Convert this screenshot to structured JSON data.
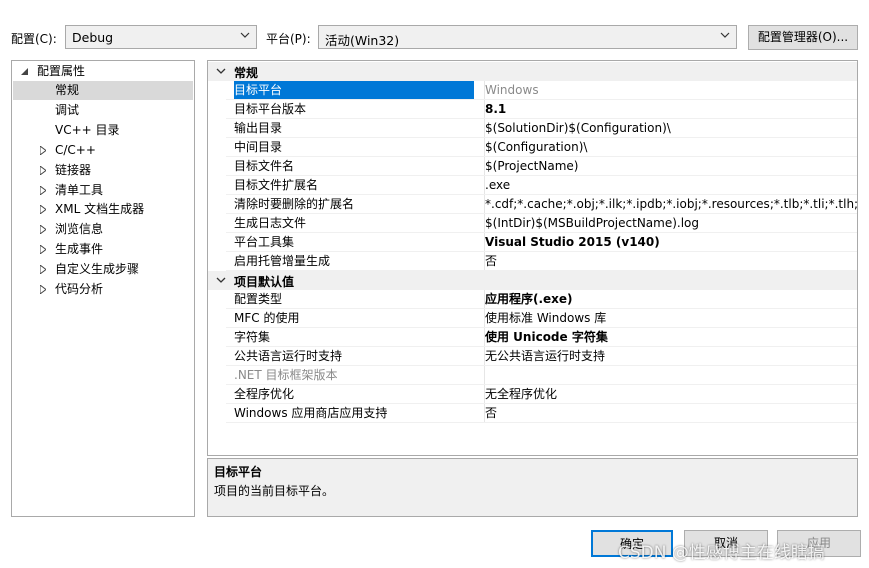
{
  "toolbar": {
    "config_label": "配置(C):",
    "config_value": "Debug",
    "platform_label": "平台(P):",
    "platform_value": "活动(Win32)",
    "config_manager_button": "配置管理器(O)..."
  },
  "tree": {
    "root": "配置属性",
    "items": [
      {
        "label": "常规",
        "expandable": false
      },
      {
        "label": "调试",
        "expandable": false
      },
      {
        "label": "VC++ 目录",
        "expandable": false
      },
      {
        "label": "C/C++",
        "expandable": true
      },
      {
        "label": "链接器",
        "expandable": true
      },
      {
        "label": "清单工具",
        "expandable": true
      },
      {
        "label": "XML 文档生成器",
        "expandable": true
      },
      {
        "label": "浏览信息",
        "expandable": true
      },
      {
        "label": "生成事件",
        "expandable": true
      },
      {
        "label": "自定义生成步骤",
        "expandable": true
      },
      {
        "label": "代码分析",
        "expandable": true
      }
    ]
  },
  "grid": {
    "categories": [
      {
        "title": "常规",
        "rows": [
          {
            "name": "目标平台",
            "value": "Windows"
          },
          {
            "name": "目标平台版本",
            "value": "8.1"
          },
          {
            "name": "输出目录",
            "value": "$(SolutionDir)$(Configuration)\\"
          },
          {
            "name": "中间目录",
            "value": "$(Configuration)\\"
          },
          {
            "name": "目标文件名",
            "value": "$(ProjectName)"
          },
          {
            "name": "目标文件扩展名",
            "value": ".exe"
          },
          {
            "name": "清除时要删除的扩展名",
            "value": "*.cdf;*.cache;*.obj;*.ilk;*.ipdb;*.iobj;*.resources;*.tlb;*.tli;*.tlh;*.tmp;*"
          },
          {
            "name": "生成日志文件",
            "value": "$(IntDir)$(MSBuildProjectName).log"
          },
          {
            "name": "平台工具集",
            "value": "Visual Studio 2015 (v140)"
          },
          {
            "name": "启用托管增量生成",
            "value": "否"
          }
        ]
      },
      {
        "title": "项目默认值",
        "rows": [
          {
            "name": "配置类型",
            "value": "应用程序(.exe)"
          },
          {
            "name": "MFC 的使用",
            "value": "使用标准 Windows 库"
          },
          {
            "name": "字符集",
            "value": "使用 Unicode 字符集"
          },
          {
            "name": "公共语言运行时支持",
            "value": "无公共语言运行时支持"
          },
          {
            "name": ".NET 目标框架版本",
            "value": ""
          },
          {
            "name": "全程序优化",
            "value": "无全程序优化"
          },
          {
            "name": "Windows 应用商店应用支持",
            "value": "否"
          }
        ]
      }
    ]
  },
  "description": {
    "title": "目标平台",
    "text": "项目的当前目标平台。"
  },
  "buttons": {
    "ok": "确定",
    "cancel": "取消",
    "apply": "应用"
  },
  "watermark": "CSDN @性感博主在线瞎搞",
  "colors": {
    "selection": "#0078d7",
    "category_bg": "#f0f0f0",
    "disabled_text": "#8a8a8a"
  },
  "icons": {
    "dropdown": "chevron-down-icon",
    "collapse": "chevron-down-icon",
    "expand": "triangle-right-icon",
    "tree_open": "triangle-down-icon"
  }
}
